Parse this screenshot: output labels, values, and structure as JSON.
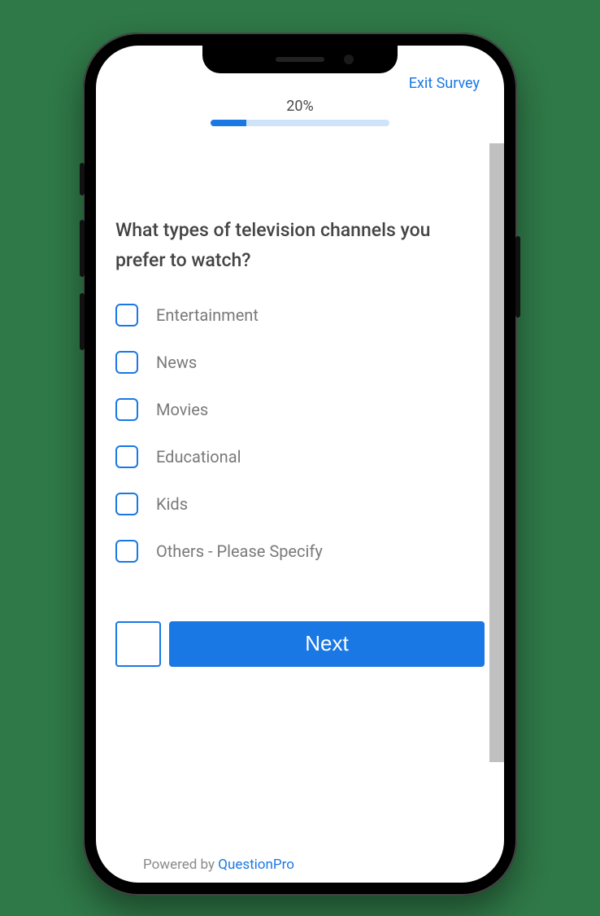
{
  "header": {
    "exit_label": "Exit Survey",
    "progress": {
      "percent": 20,
      "label": "20%"
    }
  },
  "question": {
    "text": "What types of television channels you prefer to watch?",
    "options": [
      "Entertainment",
      "News",
      "Movies",
      "Educational",
      "Kids",
      "Others - Please Specify"
    ]
  },
  "nav": {
    "next_label": "Next"
  },
  "footer": {
    "prefix": "Powered by ",
    "brand": "QuestionPro"
  }
}
